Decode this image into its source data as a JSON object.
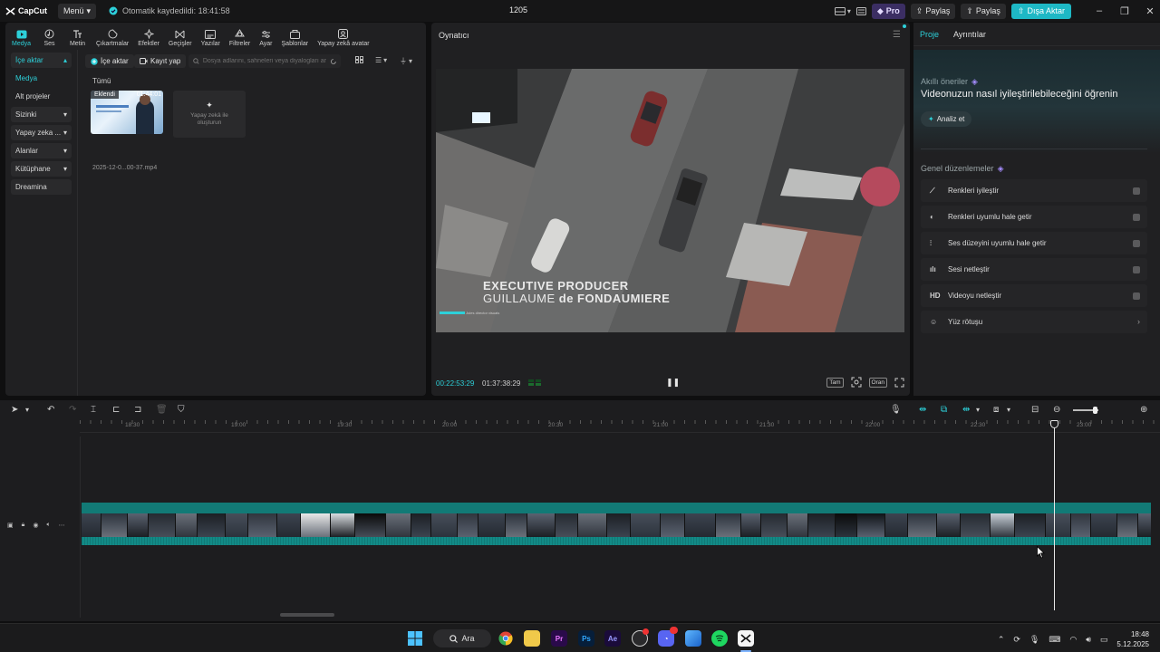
{
  "titlebar": {
    "logo": "CapCut",
    "menu_label": "Menü",
    "autosave": "Otomatik kaydedildi: 18:41:58",
    "project_title": "1205",
    "pro_label": "Pro",
    "share_label_1": "Paylaş",
    "share_label_2": "Paylaş",
    "export_label": "Dışa Aktar"
  },
  "toolbar": {
    "items": [
      {
        "label": "Medya",
        "icon": "media-icon"
      },
      {
        "label": "Ses",
        "icon": "audio-icon"
      },
      {
        "label": "Metin",
        "icon": "text-icon"
      },
      {
        "label": "Çıkartmalar",
        "icon": "sticker-icon"
      },
      {
        "label": "Efektler",
        "icon": "effects-icon"
      },
      {
        "label": "Geçişler",
        "icon": "transitions-icon"
      },
      {
        "label": "Yazılar",
        "icon": "captions-icon"
      },
      {
        "label": "Filtreler",
        "icon": "filters-icon"
      },
      {
        "label": "Ayar",
        "icon": "adjust-icon"
      },
      {
        "label": "Şablonlar",
        "icon": "templates-icon"
      },
      {
        "label": "Yapay zekâ avatar",
        "icon": "ai-avatar-icon"
      }
    ]
  },
  "sidebar": {
    "items": [
      {
        "label": "İçe aktar"
      },
      {
        "label": "Medya"
      },
      {
        "label": "Alt projeler"
      },
      {
        "label": "Sizinki"
      },
      {
        "label": "Yapay zeka ..."
      },
      {
        "label": "Alanlar"
      },
      {
        "label": "Kütüphane"
      },
      {
        "label": "Dreamina"
      }
    ]
  },
  "media": {
    "import_label": "İçe aktar",
    "record_label": "Kayıt yap",
    "search_placeholder": "Dosya adlarını, sahneleri veya diyalogları ara...",
    "all_label": "Tümü",
    "clip_badge": "Eklendi",
    "clip_duration": "01:44:01",
    "clip_name": "2025-12-0...00-37.mp4",
    "ai_tile_line1": "Yapay zekâ ile",
    "ai_tile_line2": "oluşturun"
  },
  "player": {
    "title": "Oynatıcı",
    "credit_line1": "EXECUTIVE PRODUCER",
    "credit_line2a": "GUILLAUME",
    "credit_line2b": "de FONDAUMIERE",
    "credit_small": "Jules director visuals",
    "timecode_current": "00:22:53:29",
    "timecode_total": "01:37:38:29",
    "full_label": "Tam",
    "ratio_label": "Oran"
  },
  "rightpanel": {
    "tab_project": "Proje",
    "tab_details": "Ayrıntılar",
    "smart_label": "Akıllı öneriler",
    "smart_title": "Videonuzun nasıl iyileştirilebileceğini öğrenin",
    "analyze_label": "Analiz et",
    "general_label": "Genel düzenlemeler",
    "edits": [
      {
        "label": "Renkleri iyileştir",
        "icon": "magic-wand-icon"
      },
      {
        "label": "Renkleri uyumlu hale getir",
        "icon": "color-match-icon"
      },
      {
        "label": "Ses düzeyini uyumlu hale getir",
        "icon": "volume-sliders-icon"
      },
      {
        "label": "Sesi netleştir",
        "icon": "audio-clarify-icon"
      },
      {
        "label": "Videoyu netleştir",
        "icon": "hd-icon",
        "icon_text": "HD"
      },
      {
        "label": "Yüz rötuşu",
        "icon": "face-retouch-icon"
      }
    ]
  },
  "timeline": {
    "ticks": [
      "18:30",
      "19:00",
      "19:30",
      "20:00",
      "20:30",
      "21:00",
      "21:30",
      "22:00",
      "22:30",
      "23:00"
    ]
  },
  "taskbar": {
    "search_label": "Ara",
    "time": "18:48",
    "date": "5.12.2025",
    "apps": [
      "windows-start-icon",
      "chrome-icon",
      "file-explorer-icon",
      "premiere-pro-icon",
      "photoshop-icon",
      "after-effects-icon",
      "steam-icon",
      "discord-icon",
      "photos-icon",
      "spotify-icon",
      "capcut-icon"
    ]
  },
  "colors": {
    "accent": "#2dd0d9",
    "track": "#127a76",
    "export": "#1eb8c5",
    "pro": "#3b2e63"
  }
}
